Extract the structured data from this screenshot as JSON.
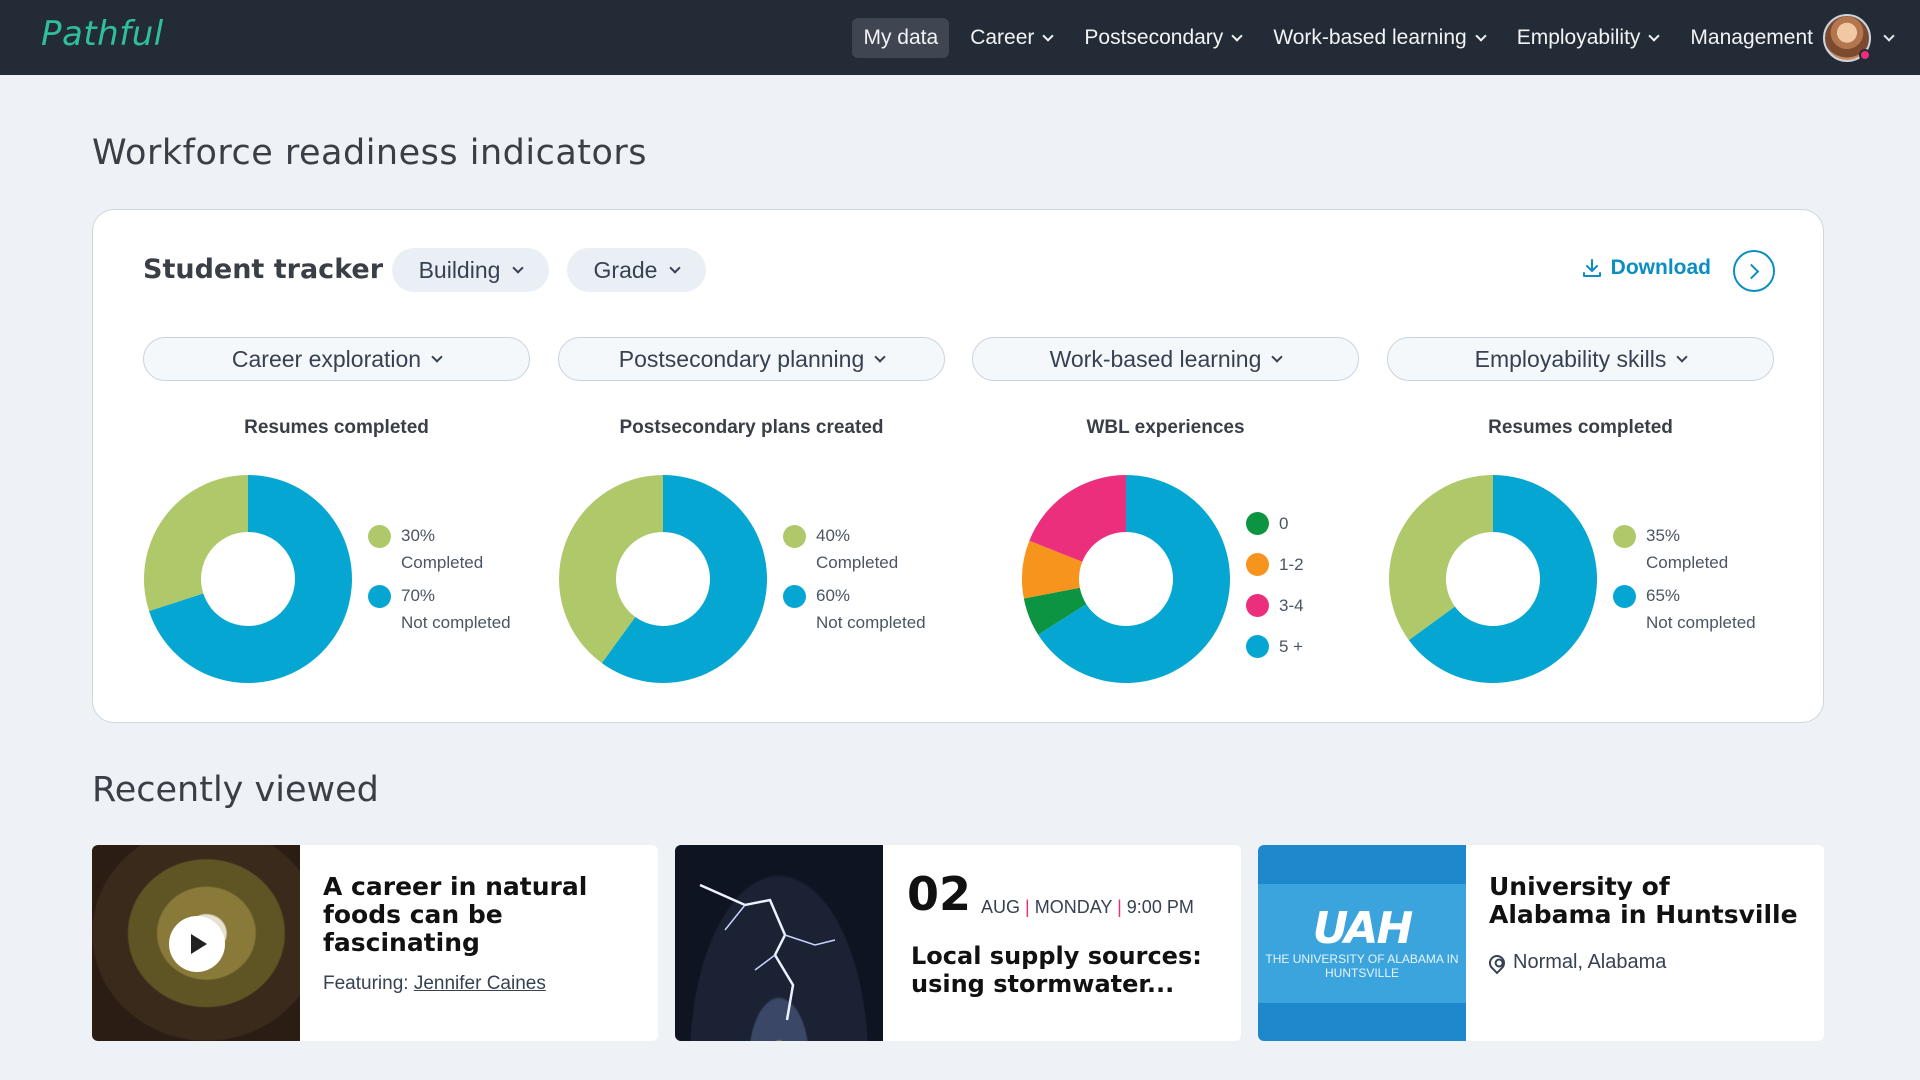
{
  "app": {
    "logo": "Pathful"
  },
  "nav": {
    "items": [
      {
        "label": "My data",
        "active": true,
        "dropdown": false
      },
      {
        "label": "Career",
        "active": false,
        "dropdown": true
      },
      {
        "label": "Postsecondary",
        "active": false,
        "dropdown": true
      },
      {
        "label": "Work-based learning",
        "active": false,
        "dropdown": true
      },
      {
        "label": "Employability",
        "active": false,
        "dropdown": true
      },
      {
        "label": "Management",
        "active": false,
        "dropdown": false
      }
    ]
  },
  "page": {
    "title": "Workforce readiness indicators"
  },
  "tracker": {
    "title": "Student tracker",
    "filters": {
      "building": "Building",
      "grade": "Grade"
    },
    "download": "Download",
    "categories": [
      "Career exploration",
      "Postsecondary planning",
      "Work-based learning",
      "Employability skills"
    ],
    "charts": [
      {
        "title": "Resumes completed",
        "legend": [
          {
            "value": "30%",
            "label": "Completed",
            "color": "#afc86a"
          },
          {
            "value": "70%",
            "label": "Not completed",
            "color": "#05a6d1"
          }
        ]
      },
      {
        "title": "Postsecondary plans created",
        "legend": [
          {
            "value": "40%",
            "label": "Completed",
            "color": "#afc86a"
          },
          {
            "value": "60%",
            "label": "Not completed",
            "color": "#05a6d1"
          }
        ]
      },
      {
        "title": "WBL experiences",
        "legend": [
          {
            "label": "0",
            "color": "#0c9443"
          },
          {
            "label": "1-2",
            "color": "#f7941d"
          },
          {
            "label": "3-4",
            "color": "#ec2f7d"
          },
          {
            "label": "5 +",
            "color": "#05a6d1"
          }
        ]
      },
      {
        "title": "Resumes completed",
        "legend": [
          {
            "value": "35%",
            "label": "Completed",
            "color": "#afc86a"
          },
          {
            "value": "65%",
            "label": "Not completed",
            "color": "#05a6d1"
          }
        ]
      }
    ]
  },
  "chart_data": [
    {
      "type": "pie",
      "title": "Resumes completed",
      "categories": [
        "Completed",
        "Not completed"
      ],
      "values": [
        30,
        70
      ]
    },
    {
      "type": "pie",
      "title": "Postsecondary plans created",
      "categories": [
        "Completed",
        "Not completed"
      ],
      "values": [
        40,
        60
      ]
    },
    {
      "type": "pie",
      "title": "WBL experiences",
      "categories": [
        "0",
        "1-2",
        "3-4",
        "5 +"
      ],
      "values": [
        6,
        9,
        19,
        66
      ]
    },
    {
      "type": "pie",
      "title": "Resumes completed",
      "categories": [
        "Completed",
        "Not completed"
      ],
      "values": [
        35,
        65
      ]
    }
  ],
  "recent": {
    "title": "Recently viewed",
    "items": [
      {
        "title": "A career in natural foods can be fascinating",
        "featuring_label": "Featuring:",
        "featuring_name": "Jennifer Caines"
      },
      {
        "day": "02",
        "month": "AUG",
        "weekday": "MONDAY",
        "time": "9:00 PM",
        "title": "Local supply sources: using stormwater..."
      },
      {
        "title": "University of Alabama in Huntsville",
        "location": "Normal, Alabama",
        "logo_text": "UAH",
        "logo_sub": "THE UNIVERSITY OF ALABAMA IN HUNTSVILLE"
      }
    ]
  }
}
